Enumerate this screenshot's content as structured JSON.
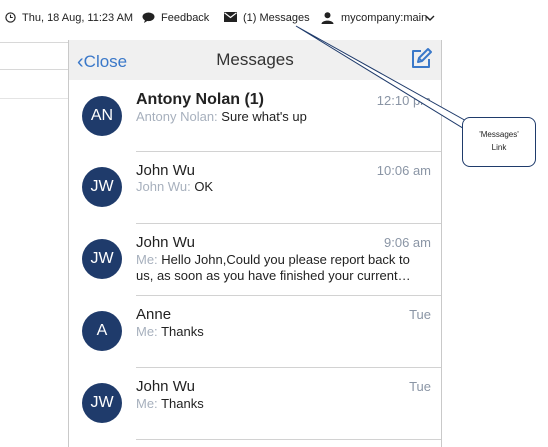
{
  "topbar": {
    "datetime": "Thu, 18 Aug, 11:23 AM",
    "datetime_icon": "clock-icon",
    "feedback": "Feedback",
    "feedback_icon": "speech-bubble-icon",
    "messages": "(1) Messages",
    "messages_icon": "envelope-icon",
    "account": "mycompany:main",
    "account_icon": "user-icon",
    "account_dropdown_icon": "chevron-down-icon"
  },
  "panel": {
    "close_label": "Close",
    "close_icon": "chevron-left-icon",
    "title": "Messages",
    "compose_icon": "compose-icon",
    "accent_color": "#3a78c9",
    "avatar_color": "#1f3b6b",
    "messages": [
      {
        "initials": "AN",
        "name": "Antony Nolan (1)",
        "time": "12:10 pm",
        "sender": "Antony Nolan:",
        "text": "Sure what's up",
        "unread": true
      },
      {
        "initials": "JW",
        "name": "John Wu",
        "time": "10:06 am",
        "sender": "John Wu:",
        "text": "OK",
        "unread": false
      },
      {
        "initials": "JW",
        "name": "John Wu",
        "time": "9:06 am",
        "sender": "Me:",
        "text": "Hello John,Could you please report back to us, as soon as you have finished your current…",
        "unread": false
      },
      {
        "initials": "A",
        "name": "Anne",
        "time": "Tue",
        "sender": "Me:",
        "text": "Thanks",
        "unread": false
      },
      {
        "initials": "JW",
        "name": "John Wu",
        "time": "Tue",
        "sender": "Me:",
        "text": "Thanks",
        "unread": false
      }
    ]
  },
  "callout": {
    "line1": "'Messages'",
    "line2": "Link"
  }
}
